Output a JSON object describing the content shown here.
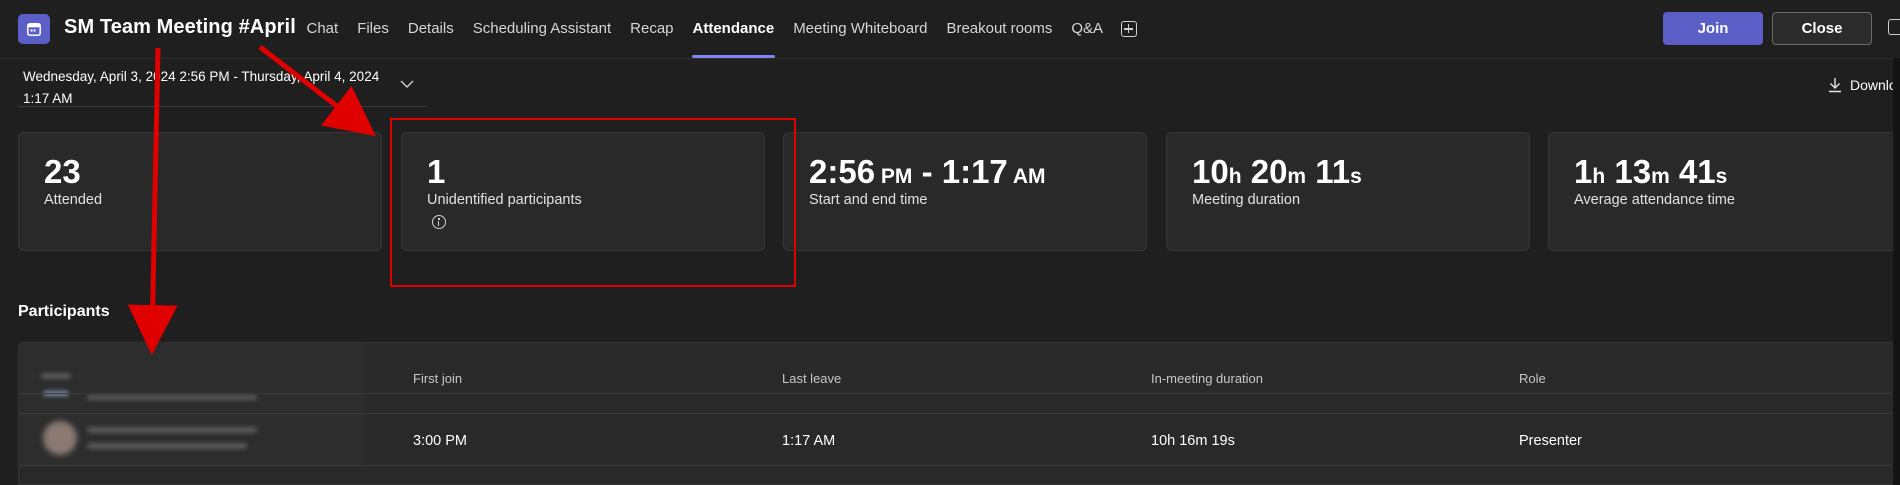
{
  "header": {
    "title": "SM Team Meeting #April",
    "tabs": [
      {
        "label": "Chat",
        "active": false
      },
      {
        "label": "Files",
        "active": false
      },
      {
        "label": "Details",
        "active": false
      },
      {
        "label": "Scheduling Assistant",
        "active": false
      },
      {
        "label": "Recap",
        "active": false
      },
      {
        "label": "Attendance",
        "active": true
      },
      {
        "label": "Meeting Whiteboard",
        "active": false
      },
      {
        "label": "Breakout rooms",
        "active": false
      },
      {
        "label": "Q&A",
        "active": false
      }
    ],
    "join_label": "Join",
    "close_label": "Close"
  },
  "date_range": {
    "text": "Wednesday, April 3, 2024 2:56 PM - Thursday, April 4, 2024 1:17 AM",
    "download_label": "Downlo"
  },
  "stats": [
    {
      "value_parts": [
        {
          "t": "23",
          "unit": false
        }
      ],
      "label": "Attended"
    },
    {
      "value_parts": [
        {
          "t": "1",
          "unit": false
        }
      ],
      "label": "Unidentified participants",
      "info": true
    },
    {
      "value_parts": [
        {
          "t": "2:56",
          "unit": false
        },
        {
          "t": " PM",
          "unit": true
        },
        {
          "t": " - 1:17",
          "unit": false
        },
        {
          "t": " AM",
          "unit": true
        }
      ],
      "label": "Start and end time"
    },
    {
      "value_parts": [
        {
          "t": "10",
          "unit": false
        },
        {
          "t": "h",
          "unit": true
        },
        {
          "t": " 20",
          "unit": false
        },
        {
          "t": "m",
          "unit": true
        },
        {
          "t": " 11",
          "unit": false
        },
        {
          "t": "s",
          "unit": true
        }
      ],
      "label": "Meeting duration"
    },
    {
      "value_parts": [
        {
          "t": "1",
          "unit": false
        },
        {
          "t": "h",
          "unit": true
        },
        {
          "t": " 13",
          "unit": false
        },
        {
          "t": "m",
          "unit": true
        },
        {
          "t": " 41",
          "unit": false
        },
        {
          "t": "s",
          "unit": true
        }
      ],
      "label": "Average attendance time"
    }
  ],
  "participants": {
    "title": "Participants",
    "columns": [
      "First join",
      "Last leave",
      "In-meeting duration",
      "Role"
    ],
    "rows": [
      {
        "first_join": "3:00 PM",
        "last_leave": "1:17 AM",
        "duration": "10h 16m 19s",
        "role": "Presenter"
      }
    ]
  },
  "colors": {
    "accent": "#5b5fc7",
    "tab_underline": "#7f85f5",
    "annotation": "#e00000",
    "background": "#1f1f1f",
    "card": "#292929"
  },
  "icons": [
    "calendar-icon",
    "add-tab-icon",
    "chevron-down-icon",
    "download-icon",
    "info-icon"
  ]
}
